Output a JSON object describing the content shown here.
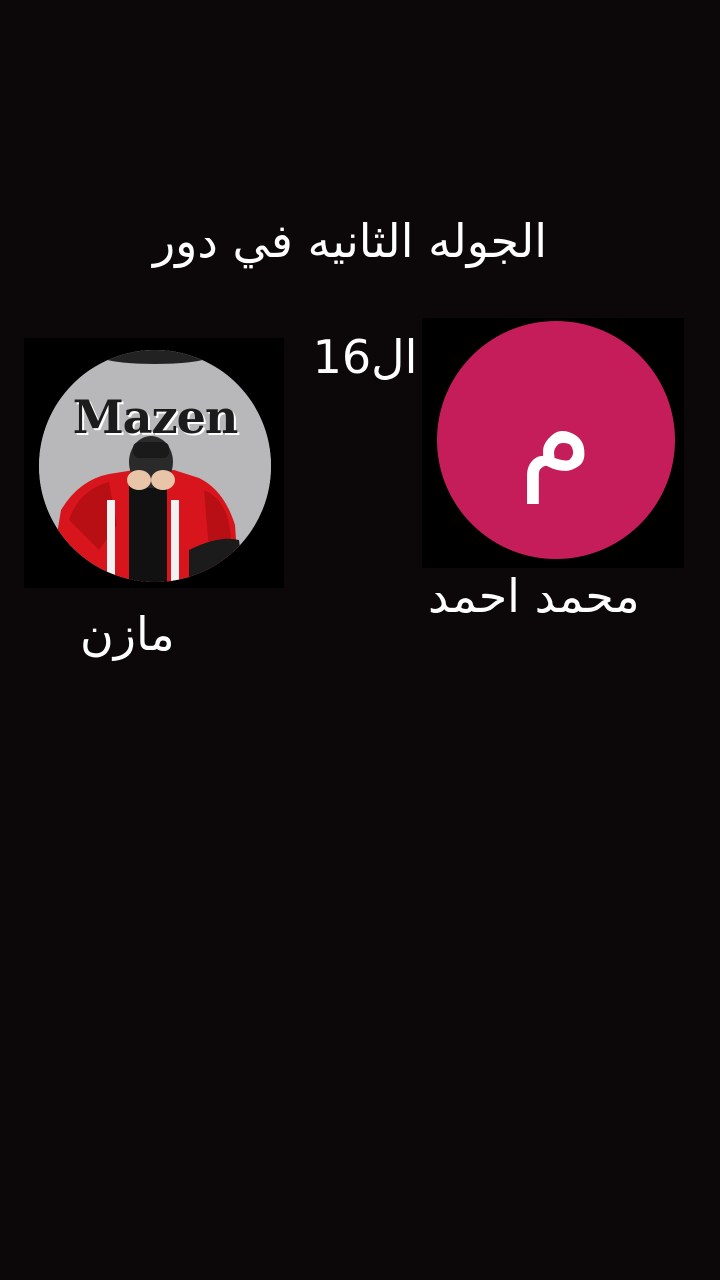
{
  "match": {
    "headline": "الجوله الثانيه في دور",
    "round": "ال16"
  },
  "players": [
    {
      "name": "مازن",
      "avatar_brand_text": "Mazen",
      "avatar_type": "photo"
    },
    {
      "name": "محمد احمد",
      "avatar_initial": "م",
      "avatar_color": "#c51d5a"
    }
  ],
  "colors": {
    "background": "#0c0809",
    "text": "#ffffff"
  }
}
